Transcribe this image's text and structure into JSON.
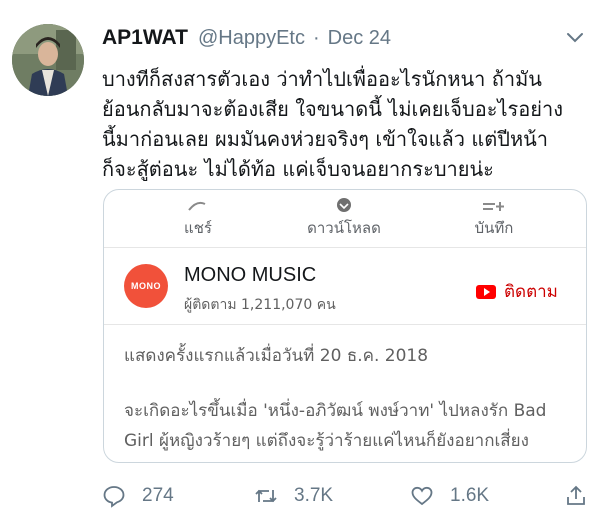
{
  "tweet": {
    "display_name": "AP1WAT",
    "handle": "@HappyEtc",
    "separator": "·",
    "date": "Dec 24",
    "text_lines": [
      "บางทีก็สงสารตัวเอง ว่าทำไปเพื่ออะไรนักหนา ถ้ามัน",
      "ย้อนกลับมาจะต้องเสีย ใจขนาดนี้ ไม่เคยเจ็บอะไรอย่าง",
      "นี้มาก่อนเลย  ผมมันคงห่วยจริงๆ เข้าใจแล้ว แต่ปีหน้า",
      "ก็จะสู้ต่อนะ ไม่ได้ท้อ แค่เจ็บจนอยากระบายน่ะ"
    ]
  },
  "card": {
    "share_row": [
      {
        "label": "แชร์",
        "icon": "share-icon"
      },
      {
        "label": "ดาวน์โหลด",
        "icon": "download-icon"
      },
      {
        "label": "บันทึก",
        "icon": "save-playlist-icon"
      }
    ],
    "channel": {
      "logo_text": "MONO",
      "name": "MONO MUSIC",
      "subscribers": "ผู้ติดตาม 1,211,070 คน",
      "subscribe_label": "ติดตาม"
    },
    "first_shown": "แสดงครั้งแรกแล้วเมื่อวันที่ 20 ธ.ค. 2018",
    "description_lines": [
      "จะเกิดอะไรขึ้นเมื่อ 'หนึ่ง-อภิวัฒน์ พงษ์วาท' ไปหลงรัก Bad",
      "Girl ผู้หญิงวร้ายๆ แต่ถึงจะรู้ว่าร้ายแค่ไหนก็ยังอยากเสี่ยง"
    ]
  },
  "actions": {
    "replies": "274",
    "retweets": "3.7K",
    "likes": "1.6K"
  },
  "colors": {
    "muted": "#657786",
    "youtube_red": "#ff0000",
    "mono_orange": "#f1513a"
  }
}
